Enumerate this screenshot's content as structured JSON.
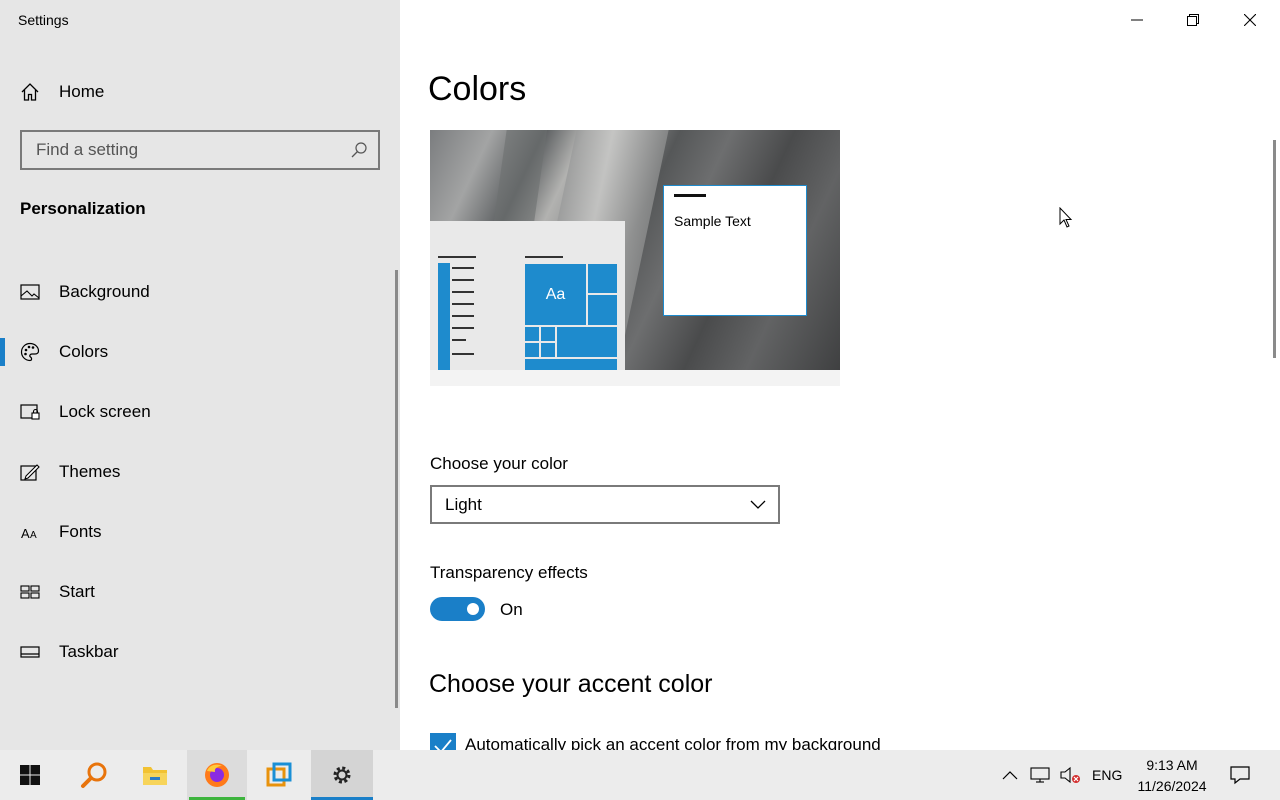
{
  "window": {
    "app_title": "Settings",
    "controls": [
      "minimize",
      "restore",
      "close"
    ]
  },
  "sidebar": {
    "home_label": "Home",
    "search_placeholder": "Find a setting",
    "section_label": "Personalization",
    "items": [
      {
        "label": "Background",
        "icon": "image-icon",
        "active": false
      },
      {
        "label": "Colors",
        "icon": "palette-icon",
        "active": true
      },
      {
        "label": "Lock screen",
        "icon": "lock-screen-icon",
        "active": false
      },
      {
        "label": "Themes",
        "icon": "themes-icon",
        "active": false
      },
      {
        "label": "Fonts",
        "icon": "fonts-icon",
        "active": false
      },
      {
        "label": "Start",
        "icon": "start-icon",
        "active": false
      },
      {
        "label": "Taskbar",
        "icon": "taskbar-icon",
        "active": false
      }
    ]
  },
  "main": {
    "title": "Colors",
    "preview": {
      "sample_text": "Sample Text",
      "tile_text": "Aa"
    },
    "choose_color": {
      "label": "Choose your color",
      "selected": "Light"
    },
    "transparency": {
      "label": "Transparency effects",
      "state": "On",
      "enabled": true
    },
    "accent": {
      "heading": "Choose your accent color",
      "auto_pick_label": "Automatically pick an accent color from my background",
      "auto_pick_checked": true
    }
  },
  "taskbar": {
    "apps": [
      "start-icon",
      "search-icon",
      "file-explorer-icon",
      "firefox-icon",
      "app-icon",
      "settings-icon"
    ],
    "language": "ENG",
    "time": "9:13 AM",
    "date": "11/26/2024"
  },
  "colors": {
    "accent": "#1a7fc8",
    "tile_blue": "#1e8bcd",
    "sidebar_bg": "#e6e6e6",
    "taskbar_bg": "#ececec"
  }
}
